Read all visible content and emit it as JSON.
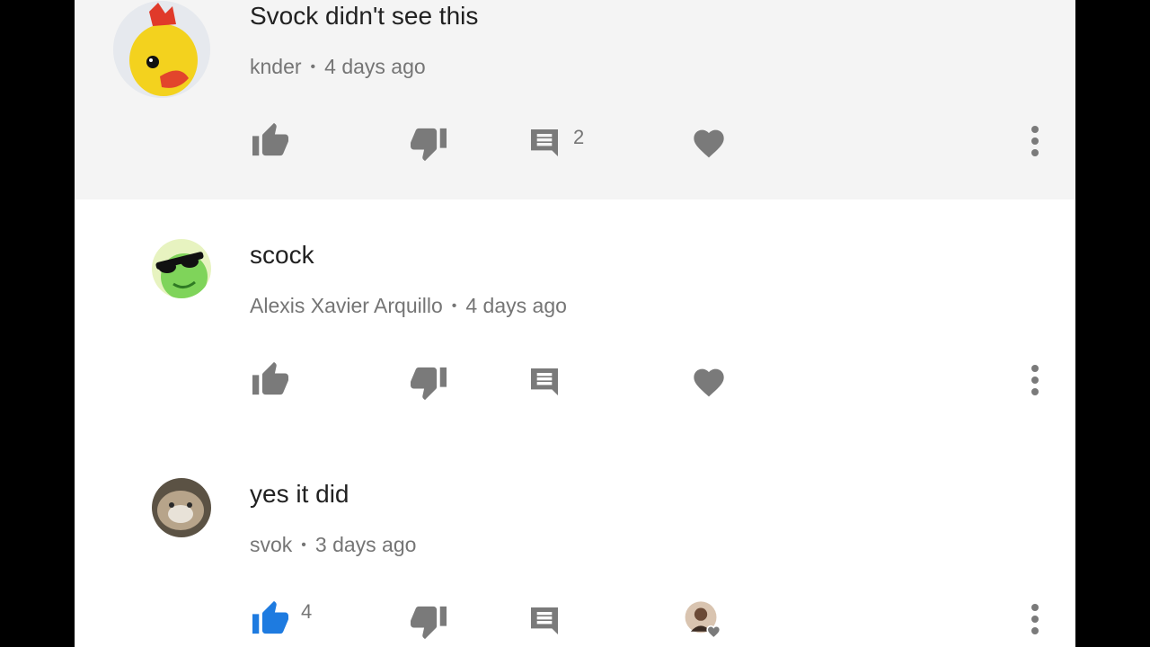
{
  "colors": {
    "icon": "#7a7a7a",
    "liked": "#1e7be0",
    "highlight_bg": "#f4f4f4",
    "text": "#212121",
    "meta": "#757575"
  },
  "comments": [
    {
      "text": "Svock didn't see this",
      "author": "knder",
      "time": "4 days ago",
      "reply_count": "2",
      "like_count": "",
      "liked": false,
      "hearted_by_creator": false,
      "highlighted": true,
      "avatar": "duck-avatar"
    },
    {
      "text": "scock",
      "author": "Alexis Xavier Arquillo",
      "time": "4 days ago",
      "reply_count": "",
      "like_count": "",
      "liked": false,
      "hearted_by_creator": false,
      "highlighted": false,
      "avatar": "frog-sunglasses-avatar"
    },
    {
      "text": "yes it did",
      "author": "svok",
      "time": "3 days ago",
      "reply_count": "",
      "like_count": "4",
      "liked": true,
      "hearted_by_creator": true,
      "highlighted": false,
      "avatar": "hamster-avatar"
    }
  ],
  "icons": {
    "like": "thumbs-up-icon",
    "dislike": "thumbs-down-icon",
    "reply": "reply-icon",
    "heart": "heart-icon",
    "more": "more-vert-icon"
  }
}
